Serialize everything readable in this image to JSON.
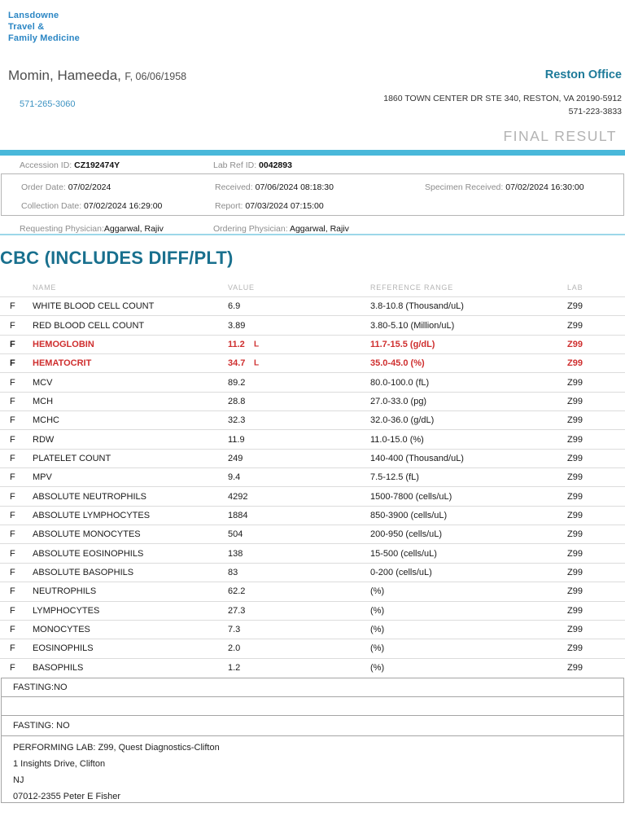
{
  "clinic": {
    "logo_lines": [
      "Lansdowne",
      "Travel &",
      "Family Medicine"
    ],
    "office_name": "Reston Office",
    "office_address": "1860 TOWN CENTER DR STE 340, RESTON, VA 20190-5912",
    "office_phone": "571-223-3833"
  },
  "patient": {
    "name": "Momin, Hameeda,",
    "demographics": "F, 06/06/1958",
    "phone": "571-265-3060"
  },
  "result_status": "FINAL RESULT",
  "order": {
    "accession_label": "Accession ID:",
    "accession_value": "CZ192474Y",
    "lab_ref_label": "Lab Ref ID:",
    "lab_ref_value": "0042893",
    "order_date_label": "Order Date:",
    "order_date": "07/02/2024",
    "received_label": "Received:",
    "received": "07/06/2024 08:18:30",
    "specimen_received_label": "Specimen Received:",
    "specimen_received": "07/02/2024  16:30:00",
    "collection_date_label": "Collection Date:",
    "collection_date": "07/02/2024 16:29:00",
    "report_label": "Report:",
    "report": "07/03/2024  07:15:00",
    "requesting_physician_label": "Requesting Physician:",
    "requesting_physician": "Aggarwal, Rajiv",
    "ordering_physician_label": "Ordering Physician:",
    "ordering_physician": "Aggarwal, Rajiv"
  },
  "panel": {
    "title": "CBC (INCLUDES DIFF/PLT)",
    "columns": [
      "NAME",
      "VALUE",
      "REFERENCE RANGE",
      "LAB"
    ],
    "rows": [
      {
        "flag": "F",
        "name": "WHITE BLOOD CELL COUNT",
        "value": "6.9",
        "abn": "",
        "range": "3.8-10.8 (Thousand/uL)",
        "lab": "Z99",
        "alert": false
      },
      {
        "flag": "F",
        "name": "RED BLOOD CELL COUNT",
        "value": "3.89",
        "abn": "",
        "range": "3.80-5.10 (Million/uL)",
        "lab": "Z99",
        "alert": false
      },
      {
        "flag": "F",
        "name": "HEMOGLOBIN",
        "value": "11.2",
        "abn": "L",
        "range": "11.7-15.5 (g/dL)",
        "lab": "Z99",
        "alert": true
      },
      {
        "flag": "F",
        "name": "HEMATOCRIT",
        "value": "34.7",
        "abn": "L",
        "range": "35.0-45.0 (%)",
        "lab": "Z99",
        "alert": true
      },
      {
        "flag": "F",
        "name": "MCV",
        "value": "89.2",
        "abn": "",
        "range": "80.0-100.0 (fL)",
        "lab": "Z99",
        "alert": false
      },
      {
        "flag": "F",
        "name": "MCH",
        "value": "28.8",
        "abn": "",
        "range": "27.0-33.0 (pg)",
        "lab": "Z99",
        "alert": false
      },
      {
        "flag": "F",
        "name": "MCHC",
        "value": "32.3",
        "abn": "",
        "range": "32.0-36.0 (g/dL)",
        "lab": "Z99",
        "alert": false
      },
      {
        "flag": "F",
        "name": "RDW",
        "value": "11.9",
        "abn": "",
        "range": "11.0-15.0 (%)",
        "lab": "Z99",
        "alert": false
      },
      {
        "flag": "F",
        "name": "PLATELET COUNT",
        "value": "249",
        "abn": "",
        "range": "140-400 (Thousand/uL)",
        "lab": "Z99",
        "alert": false
      },
      {
        "flag": "F",
        "name": "MPV",
        "value": "9.4",
        "abn": "",
        "range": "7.5-12.5 (fL)",
        "lab": "Z99",
        "alert": false
      },
      {
        "flag": "F",
        "name": "ABSOLUTE NEUTROPHILS",
        "value": "4292",
        "abn": "",
        "range": "1500-7800 (cells/uL)",
        "lab": "Z99",
        "alert": false
      },
      {
        "flag": "F",
        "name": "ABSOLUTE LYMPHOCYTES",
        "value": "1884",
        "abn": "",
        "range": "850-3900 (cells/uL)",
        "lab": "Z99",
        "alert": false
      },
      {
        "flag": "F",
        "name": "ABSOLUTE MONOCYTES",
        "value": "504",
        "abn": "",
        "range": "200-950 (cells/uL)",
        "lab": "Z99",
        "alert": false
      },
      {
        "flag": "F",
        "name": "ABSOLUTE EOSINOPHILS",
        "value": "138",
        "abn": "",
        "range": "15-500 (cells/uL)",
        "lab": "Z99",
        "alert": false
      },
      {
        "flag": "F",
        "name": "ABSOLUTE BASOPHILS",
        "value": "83",
        "abn": "",
        "range": "0-200 (cells/uL)",
        "lab": "Z99",
        "alert": false
      },
      {
        "flag": "F",
        "name": "NEUTROPHILS",
        "value": "62.2",
        "abn": "",
        "range": "(%)",
        "lab": "Z99",
        "alert": false
      },
      {
        "flag": "F",
        "name": "LYMPHOCYTES",
        "value": "27.3",
        "abn": "",
        "range": "(%)",
        "lab": "Z99",
        "alert": false
      },
      {
        "flag": "F",
        "name": "MONOCYTES",
        "value": "7.3",
        "abn": "",
        "range": "(%)",
        "lab": "Z99",
        "alert": false
      },
      {
        "flag": "F",
        "name": "EOSINOPHILS",
        "value": "2.0",
        "abn": "",
        "range": "(%)",
        "lab": "Z99",
        "alert": false
      },
      {
        "flag": "F",
        "name": "BASOPHILS",
        "value": "1.2",
        "abn": "",
        "range": "(%)",
        "lab": "Z99",
        "alert": false
      }
    ]
  },
  "footer": {
    "fasting_note_1": "FASTING:NO",
    "fasting_note_2": "FASTING: NO",
    "performing_lab_lines": [
      "PERFORMING LAB: Z99, Quest Diagnostics-Clifton",
      "1 Insights Drive, Clifton",
      "NJ",
      "07012-2355 Peter E Fisher"
    ]
  },
  "colors": {
    "brand_blue": "#2b86c4",
    "heading_teal": "#19708e",
    "office_teal": "#1d7a99",
    "teal_bar": "#49b8da",
    "alert_red": "#cf2f2f",
    "muted_gray": "#b3b3b3"
  }
}
